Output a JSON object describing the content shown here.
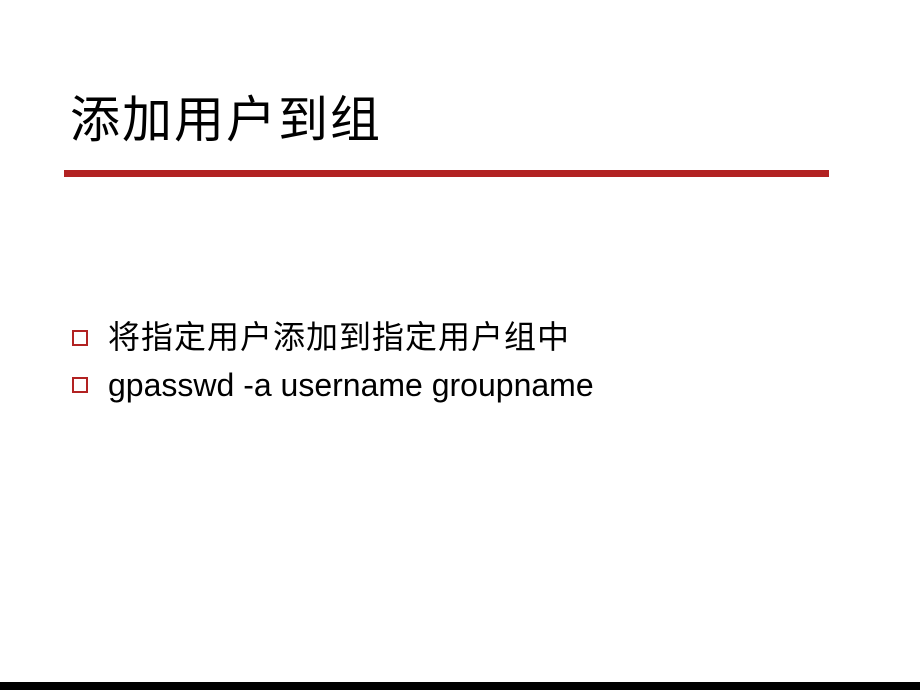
{
  "slide": {
    "title": "添加用户到组",
    "bullets": [
      {
        "text": "将指定用户添加到指定用户组中",
        "style": "cjk"
      },
      {
        "text": "gpasswd  -a username groupname",
        "style": "latin"
      }
    ]
  },
  "colors": {
    "accent": "#b22222",
    "text": "#000000",
    "background": "#ffffff"
  }
}
